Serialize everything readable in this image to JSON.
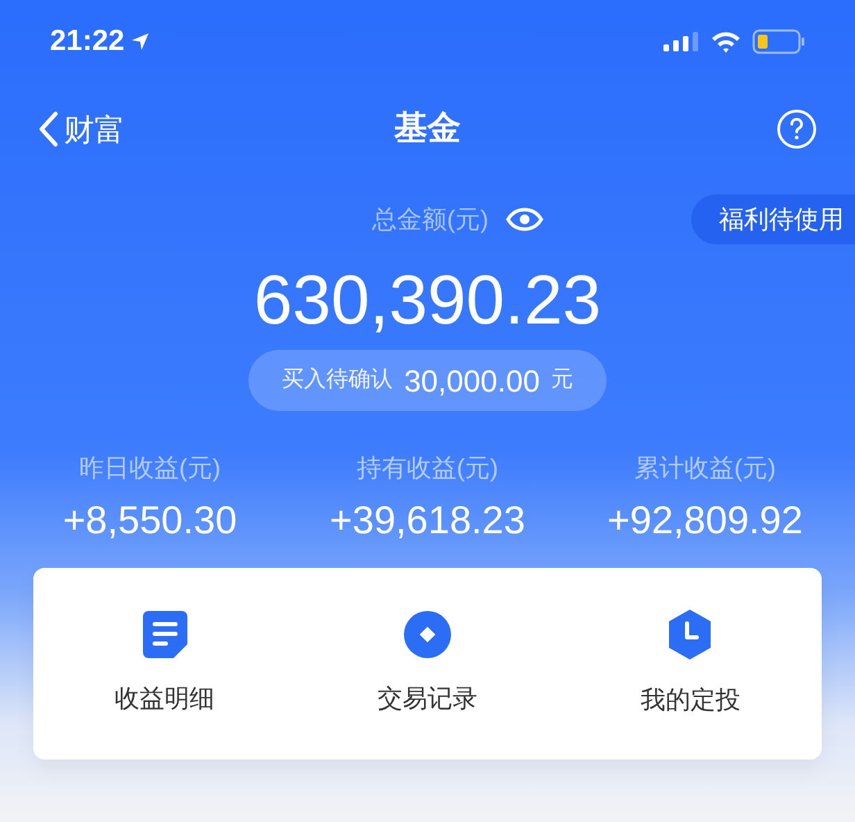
{
  "status_bar": {
    "time": "21:22"
  },
  "nav": {
    "back_label": "财富",
    "title": "基金"
  },
  "summary": {
    "label": "总金额(元)",
    "amount": "630,390.23",
    "pending_label": "买入待确认",
    "pending_amount": "30,000.00",
    "pending_unit": "元",
    "badge": "福利待使用"
  },
  "stats": [
    {
      "label": "昨日收益(元)",
      "value": "+8,550.30"
    },
    {
      "label": "持有收益(元)",
      "value": "+39,618.23"
    },
    {
      "label": "累计收益(元)",
      "value": "+92,809.92"
    }
  ],
  "actions": [
    {
      "kind": "document",
      "label": "收益明细"
    },
    {
      "kind": "disc",
      "label": "交易记录"
    },
    {
      "kind": "clock",
      "label": "我的定投"
    }
  ]
}
